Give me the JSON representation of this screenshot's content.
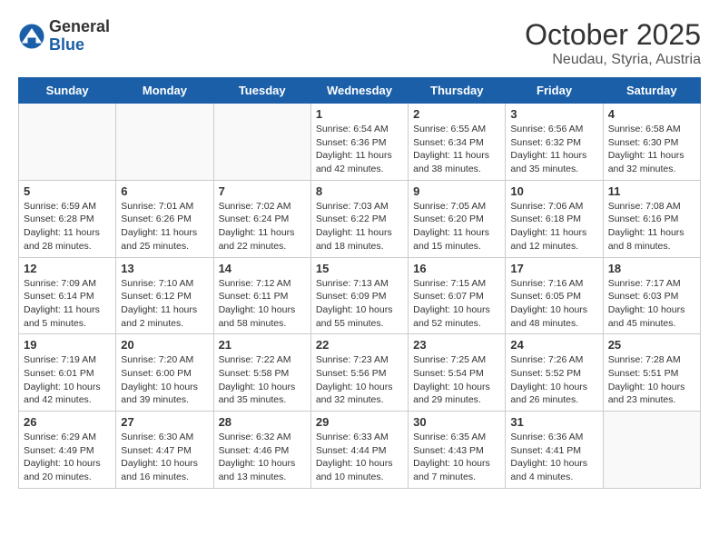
{
  "header": {
    "logo": {
      "general": "General",
      "blue": "Blue"
    },
    "title": "October 2025",
    "subtitle": "Neudau, Styria, Austria"
  },
  "weekdays": [
    "Sunday",
    "Monday",
    "Tuesday",
    "Wednesday",
    "Thursday",
    "Friday",
    "Saturday"
  ],
  "weeks": [
    [
      {
        "day": "",
        "info": ""
      },
      {
        "day": "",
        "info": ""
      },
      {
        "day": "",
        "info": ""
      },
      {
        "day": "1",
        "info": "Sunrise: 6:54 AM\nSunset: 6:36 PM\nDaylight: 11 hours\nand 42 minutes."
      },
      {
        "day": "2",
        "info": "Sunrise: 6:55 AM\nSunset: 6:34 PM\nDaylight: 11 hours\nand 38 minutes."
      },
      {
        "day": "3",
        "info": "Sunrise: 6:56 AM\nSunset: 6:32 PM\nDaylight: 11 hours\nand 35 minutes."
      },
      {
        "day": "4",
        "info": "Sunrise: 6:58 AM\nSunset: 6:30 PM\nDaylight: 11 hours\nand 32 minutes."
      }
    ],
    [
      {
        "day": "5",
        "info": "Sunrise: 6:59 AM\nSunset: 6:28 PM\nDaylight: 11 hours\nand 28 minutes."
      },
      {
        "day": "6",
        "info": "Sunrise: 7:01 AM\nSunset: 6:26 PM\nDaylight: 11 hours\nand 25 minutes."
      },
      {
        "day": "7",
        "info": "Sunrise: 7:02 AM\nSunset: 6:24 PM\nDaylight: 11 hours\nand 22 minutes."
      },
      {
        "day": "8",
        "info": "Sunrise: 7:03 AM\nSunset: 6:22 PM\nDaylight: 11 hours\nand 18 minutes."
      },
      {
        "day": "9",
        "info": "Sunrise: 7:05 AM\nSunset: 6:20 PM\nDaylight: 11 hours\nand 15 minutes."
      },
      {
        "day": "10",
        "info": "Sunrise: 7:06 AM\nSunset: 6:18 PM\nDaylight: 11 hours\nand 12 minutes."
      },
      {
        "day": "11",
        "info": "Sunrise: 7:08 AM\nSunset: 6:16 PM\nDaylight: 11 hours\nand 8 minutes."
      }
    ],
    [
      {
        "day": "12",
        "info": "Sunrise: 7:09 AM\nSunset: 6:14 PM\nDaylight: 11 hours\nand 5 minutes."
      },
      {
        "day": "13",
        "info": "Sunrise: 7:10 AM\nSunset: 6:12 PM\nDaylight: 11 hours\nand 2 minutes."
      },
      {
        "day": "14",
        "info": "Sunrise: 7:12 AM\nSunset: 6:11 PM\nDaylight: 10 hours\nand 58 minutes."
      },
      {
        "day": "15",
        "info": "Sunrise: 7:13 AM\nSunset: 6:09 PM\nDaylight: 10 hours\nand 55 minutes."
      },
      {
        "day": "16",
        "info": "Sunrise: 7:15 AM\nSunset: 6:07 PM\nDaylight: 10 hours\nand 52 minutes."
      },
      {
        "day": "17",
        "info": "Sunrise: 7:16 AM\nSunset: 6:05 PM\nDaylight: 10 hours\nand 48 minutes."
      },
      {
        "day": "18",
        "info": "Sunrise: 7:17 AM\nSunset: 6:03 PM\nDaylight: 10 hours\nand 45 minutes."
      }
    ],
    [
      {
        "day": "19",
        "info": "Sunrise: 7:19 AM\nSunset: 6:01 PM\nDaylight: 10 hours\nand 42 minutes."
      },
      {
        "day": "20",
        "info": "Sunrise: 7:20 AM\nSunset: 6:00 PM\nDaylight: 10 hours\nand 39 minutes."
      },
      {
        "day": "21",
        "info": "Sunrise: 7:22 AM\nSunset: 5:58 PM\nDaylight: 10 hours\nand 35 minutes."
      },
      {
        "day": "22",
        "info": "Sunrise: 7:23 AM\nSunset: 5:56 PM\nDaylight: 10 hours\nand 32 minutes."
      },
      {
        "day": "23",
        "info": "Sunrise: 7:25 AM\nSunset: 5:54 PM\nDaylight: 10 hours\nand 29 minutes."
      },
      {
        "day": "24",
        "info": "Sunrise: 7:26 AM\nSunset: 5:52 PM\nDaylight: 10 hours\nand 26 minutes."
      },
      {
        "day": "25",
        "info": "Sunrise: 7:28 AM\nSunset: 5:51 PM\nDaylight: 10 hours\nand 23 minutes."
      }
    ],
    [
      {
        "day": "26",
        "info": "Sunrise: 6:29 AM\nSunset: 4:49 PM\nDaylight: 10 hours\nand 20 minutes."
      },
      {
        "day": "27",
        "info": "Sunrise: 6:30 AM\nSunset: 4:47 PM\nDaylight: 10 hours\nand 16 minutes."
      },
      {
        "day": "28",
        "info": "Sunrise: 6:32 AM\nSunset: 4:46 PM\nDaylight: 10 hours\nand 13 minutes."
      },
      {
        "day": "29",
        "info": "Sunrise: 6:33 AM\nSunset: 4:44 PM\nDaylight: 10 hours\nand 10 minutes."
      },
      {
        "day": "30",
        "info": "Sunrise: 6:35 AM\nSunset: 4:43 PM\nDaylight: 10 hours\nand 7 minutes."
      },
      {
        "day": "31",
        "info": "Sunrise: 6:36 AM\nSunset: 4:41 PM\nDaylight: 10 hours\nand 4 minutes."
      },
      {
        "day": "",
        "info": ""
      }
    ]
  ]
}
